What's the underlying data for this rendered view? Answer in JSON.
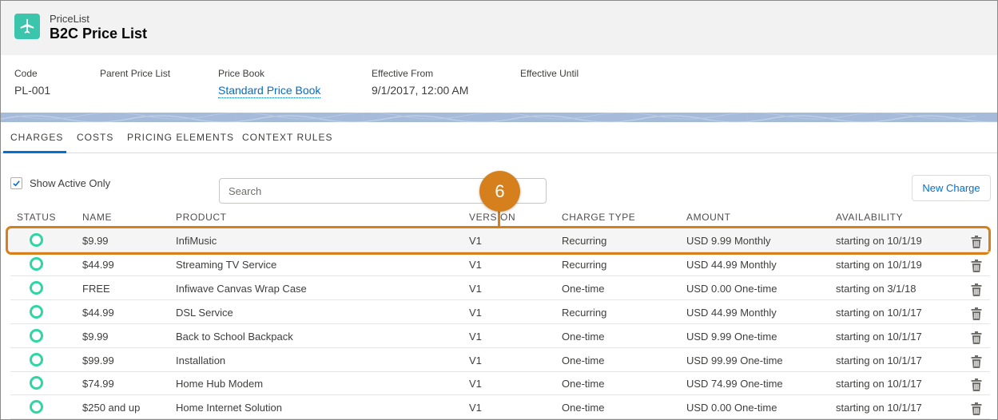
{
  "header": {
    "object_type": "PriceList",
    "title": "B2C Price List",
    "icon": "pricelist-plane-icon",
    "icon_color": "#3bc5ad"
  },
  "fields": [
    {
      "label": "Code",
      "value": "PL-001",
      "link": false
    },
    {
      "label": "Parent Price List",
      "value": "",
      "link": false
    },
    {
      "label": "Price Book",
      "value": "Standard Price Book",
      "link": true
    },
    {
      "label": "Effective From",
      "value": "9/1/2017, 12:00 AM",
      "link": false
    },
    {
      "label": "Effective Until",
      "value": "",
      "link": false
    }
  ],
  "tabs": [
    "CHARGES",
    "COSTS",
    "PRICING ELEMENTS",
    "CONTEXT RULES"
  ],
  "active_tab": "CHARGES",
  "toolbar": {
    "show_active_label": "Show Active Only",
    "show_active_checked": true,
    "search_placeholder": "Search",
    "new_button_label": "New Charge"
  },
  "callout": {
    "number": "6",
    "color": "#d6801d"
  },
  "table": {
    "columns": [
      "STATUS",
      "NAME",
      "PRODUCT",
      "VERSION",
      "CHARGE TYPE",
      "AMOUNT",
      "AVAILABILITY"
    ],
    "rows": [
      {
        "name": "$9.99",
        "product": "InfiMusic",
        "version": "V1",
        "charge_type": "Recurring",
        "amount": "USD 9.99 Monthly",
        "availability": "starting on 10/1/19"
      },
      {
        "name": "$44.99",
        "product": "Streaming TV Service",
        "version": "V1",
        "charge_type": "Recurring",
        "amount": "USD 44.99 Monthly",
        "availability": "starting on 10/1/19"
      },
      {
        "name": "FREE",
        "product": "Infiwave Canvas Wrap Case",
        "version": "V1",
        "charge_type": "One-time",
        "amount": "USD 0.00 One-time",
        "availability": "starting on 3/1/18"
      },
      {
        "name": "$44.99",
        "product": "DSL Service",
        "version": "V1",
        "charge_type": "Recurring",
        "amount": "USD 44.99 Monthly",
        "availability": "starting on 10/1/17"
      },
      {
        "name": "$9.99",
        "product": "Back to School Backpack",
        "version": "V1",
        "charge_type": "One-time",
        "amount": "USD 9.99 One-time",
        "availability": "starting on 10/1/17"
      },
      {
        "name": "$99.99",
        "product": "Installation",
        "version": "V1",
        "charge_type": "One-time",
        "amount": "USD 99.99 One-time",
        "availability": "starting on 10/1/17"
      },
      {
        "name": "$74.99",
        "product": "Home Hub Modem",
        "version": "V1",
        "charge_type": "One-time",
        "amount": "USD 74.99 One-time",
        "availability": "starting on 10/1/17"
      },
      {
        "name": "$250 and up",
        "product": "Home Internet Solution",
        "version": "V1",
        "charge_type": "One-time",
        "amount": "USD 0.00 One-time",
        "availability": "starting on 10/1/17"
      }
    ]
  },
  "colors": {
    "status_active": "#2fd5a5",
    "link": "#006dcc",
    "tab_active": "#0070d2",
    "band": "#a5bbd9"
  }
}
